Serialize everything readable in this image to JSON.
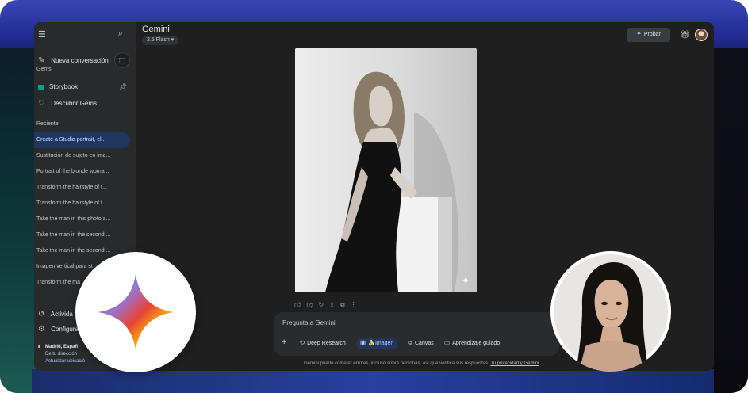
{
  "colors": {
    "app_bg": "#1f1f1f",
    "sidebar_bg": "#282a2c",
    "active_item": "#1f3760",
    "link": "#a8c7fa"
  },
  "sidebar": {
    "menu_icon": "menu-icon",
    "search_icon": "search-icon",
    "new_chat": "Nueva conversación",
    "gems_title": "Gems",
    "storybook": "Storybook",
    "explore_gems": "Descubrir Gems",
    "recent_title": "Reciente",
    "recent_items": [
      "Create a Studio portrait, el...",
      "Sustitución de sujeto en ima...",
      "Portrait of the blonde woma...",
      "Transform the hairstyle of t...",
      "Transform the hairstyle of t...",
      "Take the man in this photo a...",
      "Take the man in the second ...",
      "Take the man in the second ...",
      "Imagen vertical para st",
      "Transform the ma"
    ],
    "activity": "Activida",
    "settings": "Configura",
    "location_city": "Madrid, Españ",
    "location_line2": "De tu dirección I",
    "location_link": "Actualizar ubicació"
  },
  "header": {
    "title": "Gemini",
    "model": "2.5 Flash",
    "try_button": "Probar"
  },
  "input": {
    "placeholder": "Pregunta a Gemini",
    "tools": {
      "deep_research": "Deep Research",
      "image": "Imagen",
      "image_emoji": "🍌",
      "canvas": "Canvas",
      "guided_learning": "Aprendizaje guiado"
    }
  },
  "disclaimer": {
    "text": "Gemini puede cometer errores, incluso sobre personas, así que verifica sus respuestas.",
    "link": "Tu privacidad y Gemini"
  }
}
